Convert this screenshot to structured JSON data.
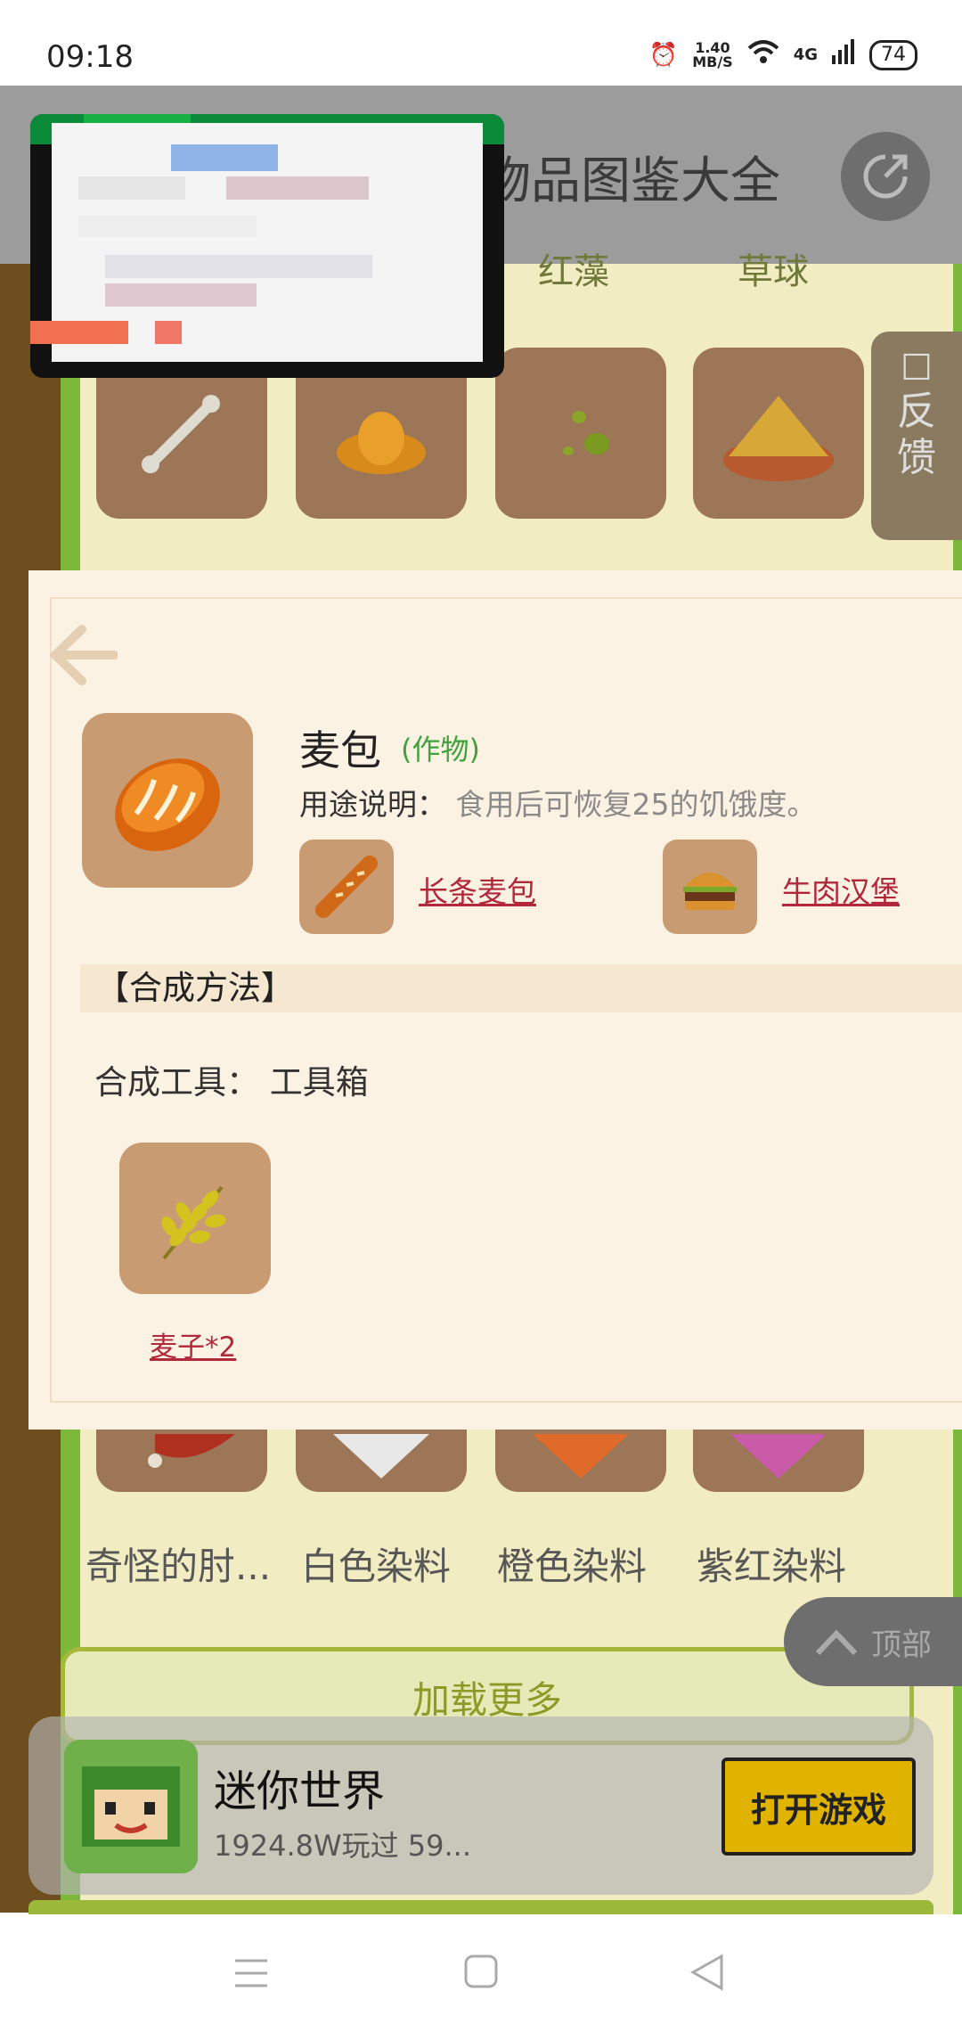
{
  "status_bar": {
    "time": "09:18",
    "net_speed_value": "1.40",
    "net_speed_unit": "MB/S",
    "network": "4G",
    "battery": "74"
  },
  "header": {
    "title": "物品图鉴大全",
    "title_prefix_partial": "…"
  },
  "categories_partial": [
    "红藻",
    "草球"
  ],
  "feedback_label": "反馈",
  "item": {
    "name": "麦包",
    "type": "(作物)",
    "usage_label": "用途说明：",
    "usage_value": "食用后可恢复25的饥饿度。",
    "related": [
      {
        "label": "长条麦包",
        "icon": "baguette-icon"
      },
      {
        "label": "牛肉汉堡",
        "icon": "burger-icon"
      }
    ],
    "section_title": "【合成方法】",
    "tool_line": "合成工具： 工具箱",
    "material": {
      "label": "麦子*2",
      "icon": "wheat-icon"
    }
  },
  "lower_grid": [
    "奇怪的肘...",
    "白色染料",
    "橙色染料",
    "紫红染料"
  ],
  "top_button": "顶部",
  "load_more": "加载更多",
  "app_banner": {
    "name": "迷你世界",
    "sub": "1924.8W玩过 59...",
    "button": "打开游戏"
  },
  "colors": {
    "accent_green": "#7cb83a",
    "link_red": "#b0283a",
    "button_yellow": "#e0b300"
  }
}
